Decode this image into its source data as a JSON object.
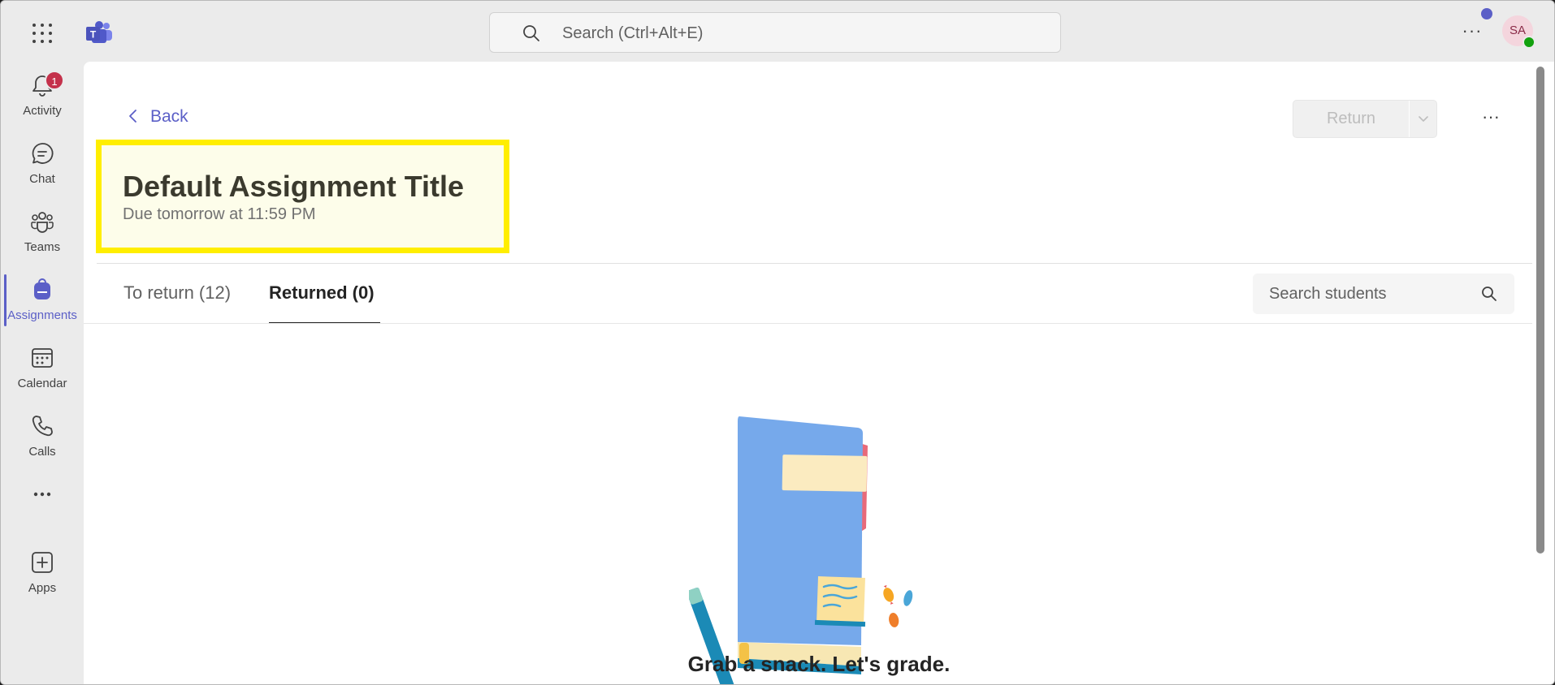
{
  "topbar": {
    "search_placeholder": "Search (Ctrl+Alt+E)",
    "more_label": "···",
    "avatar_initials": "SA"
  },
  "rail": {
    "items": [
      {
        "label": "Activity",
        "icon": "bell-icon",
        "badge": "1"
      },
      {
        "label": "Chat",
        "icon": "chat-icon"
      },
      {
        "label": "Teams",
        "icon": "teams-icon"
      },
      {
        "label": "Assignments",
        "icon": "backpack-icon",
        "active": true
      },
      {
        "label": "Calendar",
        "icon": "calendar-icon"
      },
      {
        "label": "Calls",
        "icon": "phone-icon"
      },
      {
        "label": "",
        "icon": "more-icon"
      },
      {
        "label": "Apps",
        "icon": "add-apps-icon"
      }
    ]
  },
  "assignment": {
    "back_label": "Back",
    "return_label": "Return",
    "more_label": "···",
    "title": "Default Assignment Title",
    "due": "Due tomorrow at 11:59 PM"
  },
  "tabs": [
    {
      "label": "To return (12)"
    },
    {
      "label": "Returned (0)",
      "selected": true
    }
  ],
  "student_search": {
    "placeholder": "Search students"
  },
  "empty_state": {
    "message": "Grab a snack. Let's grade."
  },
  "colors": {
    "accent": "#5b5fc7",
    "highlight_border": "#ffee00",
    "badge": "#c4314b",
    "presence": "#13a10e"
  }
}
